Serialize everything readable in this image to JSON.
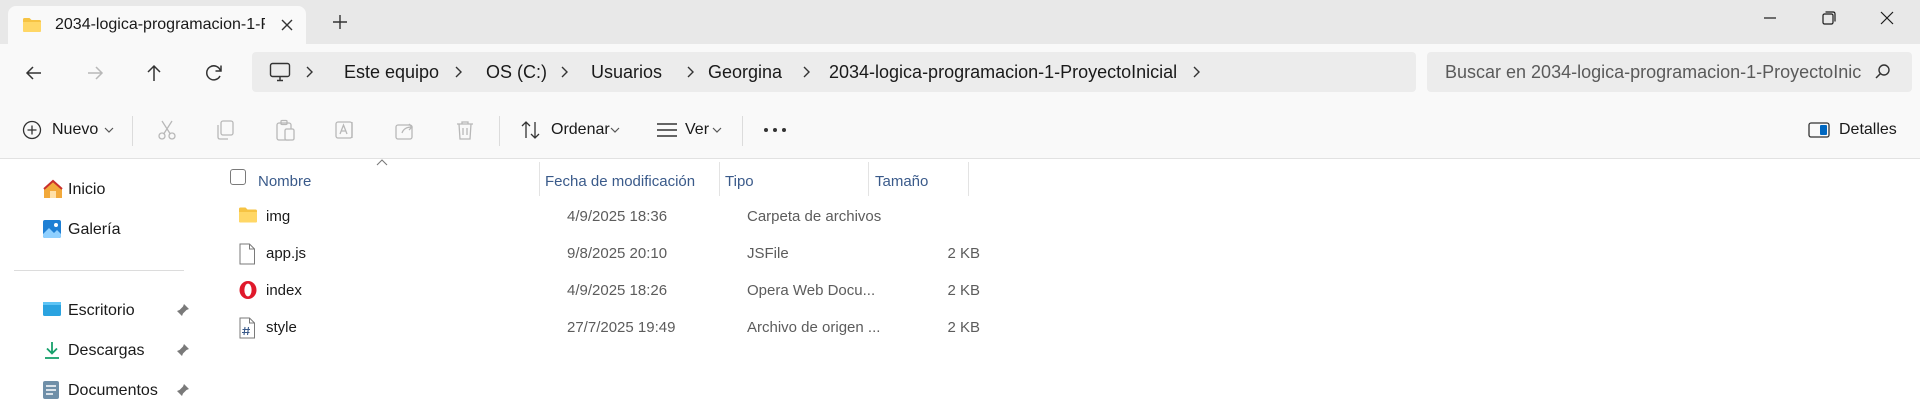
{
  "tab": {
    "title": "2034-logica-programacion-1-P",
    "close_icon": "close-icon",
    "new_tab_icon": "plus-icon"
  },
  "window_controls": [
    "minimize-icon",
    "restore-icon",
    "close-icon"
  ],
  "nav": {
    "buttons": [
      "back-arrow-icon",
      "forward-arrow-icon",
      "up-arrow-icon",
      "refresh-icon"
    ],
    "breadcrumb": [
      "Este equipo",
      "OS (C:)",
      "Usuarios",
      "Georgina",
      "2034-logica-programacion-1-ProyectoInicial"
    ],
    "search_placeholder": "Buscar en 2034-logica-programacion-1-ProyectoInic"
  },
  "commands": {
    "new_label": "Nuevo",
    "sort_label": "Ordenar",
    "view_label": "Ver",
    "details_label": "Detalles"
  },
  "sidebar": {
    "items": [
      {
        "label": "Inicio",
        "icon": "home-icon",
        "pinned": false
      },
      {
        "label": "Galería",
        "icon": "gallery-icon",
        "pinned": false
      },
      {
        "label": "Escritorio",
        "icon": "desktop-icon",
        "pinned": true
      },
      {
        "label": "Descargas",
        "icon": "download-icon",
        "pinned": true
      },
      {
        "label": "Documentos",
        "icon": "documents-icon",
        "pinned": true
      }
    ]
  },
  "columns": [
    "Nombre",
    "Fecha de modificación",
    "Tipo",
    "Tamaño"
  ],
  "files": [
    {
      "name": "img",
      "date": "4/9/2025 18:36",
      "type": "Carpeta de archivos",
      "size": "",
      "icon": "folder-icon"
    },
    {
      "name": "app.js",
      "date": "9/8/2025 20:10",
      "type": "JSFile",
      "size": "2 KB",
      "icon": "file-icon"
    },
    {
      "name": "index",
      "date": "4/9/2025 18:26",
      "type": "Opera Web Docu...",
      "size": "2 KB",
      "icon": "opera-icon"
    },
    {
      "name": "style",
      "date": "27/7/2025 19:49",
      "type": "Archivo de origen ...",
      "size": "2 KB",
      "icon": "css-file-icon"
    }
  ],
  "colors": {
    "folder": "#f6c343",
    "opera": "#e0192b",
    "accent": "#0067c0",
    "header_text": "#3a5a8a"
  }
}
